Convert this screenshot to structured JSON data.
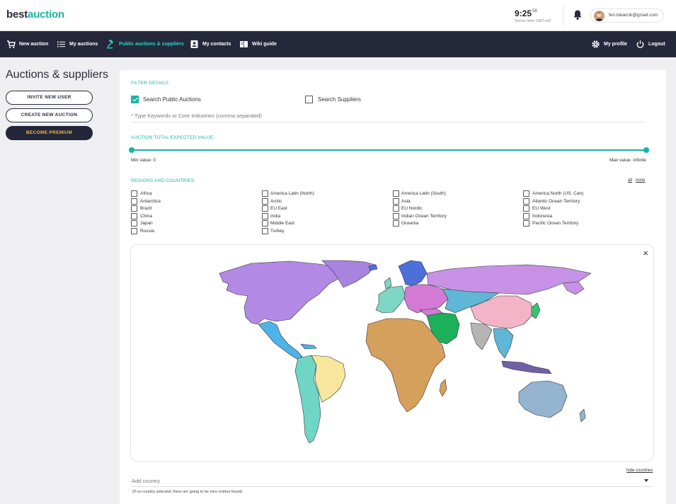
{
  "brand": {
    "part1": "best",
    "part2": "auction"
  },
  "clock": {
    "time": "9:25",
    "seconds": "58",
    "timezone": "Server time GMT+02"
  },
  "user": {
    "email": "feri.tokarcik@gmail.com"
  },
  "nav": {
    "new_auction": "New auction",
    "my_auctions": "My auctions",
    "public_auctions": "Public auctions & suppliers",
    "my_contacts": "My contacts",
    "wiki_guide": "Wiki guide",
    "my_profile": "My profile",
    "logout": "Logout"
  },
  "sidebar": {
    "title": "Auctions & suppliers",
    "invite_button": "INVITE NEW USER",
    "create_button": "CREATE NEW AUCTION",
    "premium_button": "BECOME PREMIUM"
  },
  "filter": {
    "section_label": "FILTER DETAILS",
    "search_public": {
      "label": "Search Public Auctions",
      "checked": true
    },
    "search_suppliers": {
      "label": "Search Suppliers",
      "checked": false
    },
    "keywords_placeholder": "* Type Keywords or Core Industries (comma separated)"
  },
  "value": {
    "section_label": "AUCTION TOTAL EXPECTED VALUE:",
    "min_label": "Min value: 0",
    "max_label": "Max value: infinite",
    "min_fraction": 0,
    "max_fraction": 1
  },
  "regions": {
    "section_label": "REGIONS AND COUNTRIES:",
    "all_link": "all",
    "none_link": "none",
    "columns": [
      [
        "Africa",
        "Antarctica",
        "Brazil",
        "China",
        "Japan",
        "Russia"
      ],
      [
        "America Latin (North)",
        "Arctic",
        "EU East",
        "India",
        "Middle East",
        "Turkey"
      ],
      [
        "America Latin (South)",
        "Asia",
        "EU Nordic",
        "Indian Ocean Territory",
        "Oceania"
      ],
      [
        "America North (US, Can)",
        "Atlantic Ocean Territory",
        "EU West",
        "Indonesia",
        "Pacific Ocean Territory"
      ]
    ]
  },
  "map": {
    "close_symbol": "×",
    "hide_link": "hide countries",
    "colors": {
      "north_america": "#b28ae6",
      "central_america": "#4fb3e8",
      "south_america": "#6fd6c6",
      "brazil": "#f7e69c",
      "africa": "#d5a05c",
      "europe_west": "#7ed6c4",
      "europe_nordic": "#4c6fd8",
      "europe_east": "#d27ad4",
      "russia": "#c792e6",
      "middle_east": "#1db05a",
      "china": "#f4b4c8",
      "india": "#b4b4b4",
      "asia": "#5fb6d6",
      "japan": "#38c274",
      "indonesia": "#7060a8",
      "oceania": "#94b4d0",
      "greenland": "#a884e0"
    }
  },
  "add_country": {
    "placeholder": "Add country",
    "note": "(If no country selected, there are going to be zero entries found)"
  }
}
